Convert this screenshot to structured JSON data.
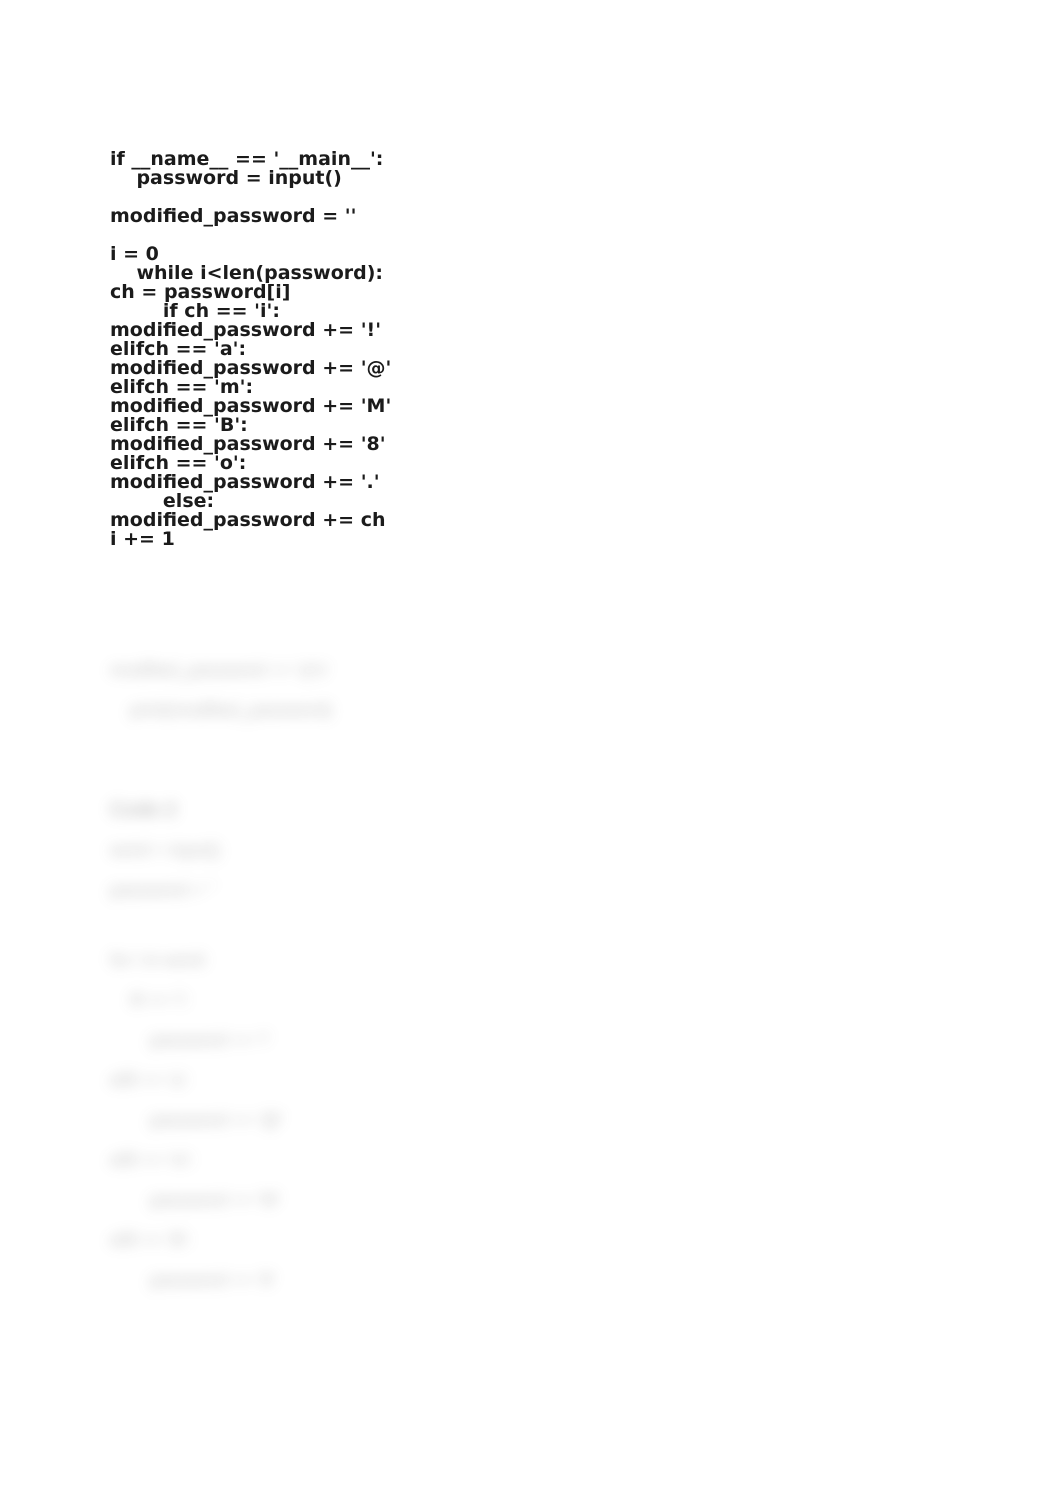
{
  "code": {
    "lines": [
      "if __name__ == '__main__':",
      "    password = input()",
      "",
      "modified_password = ''",
      "",
      "i = 0",
      "    while i<len(password):",
      "ch = password[i]",
      "        if ch == 'i':",
      "modified_password += '!'",
      "elifch == 'a':",
      "modified_password += '@'",
      "elifch == 'm':",
      "modified_password += 'M'",
      "elifch == 'B':",
      "modified_password += '8'",
      "elifch == 'o':",
      "modified_password += '.'",
      "        else:",
      "modified_password += ch",
      "i += 1"
    ]
  },
  "blurred": {
    "top_lines": [
      "modified_password += 'q*s'",
      "    print(modified_password)"
    ],
    "header": "Code 2",
    "lines": [
      "word = input()",
      "password = ''",
      "",
      "for i in word:",
      "    ifi == 'i':",
      "        password += '!'",
      "elifi == 'a':",
      "        password += '@'",
      "elifi == 'm':",
      "        password += 'M'",
      "elifi == 'B':",
      "        password += '8'"
    ]
  }
}
